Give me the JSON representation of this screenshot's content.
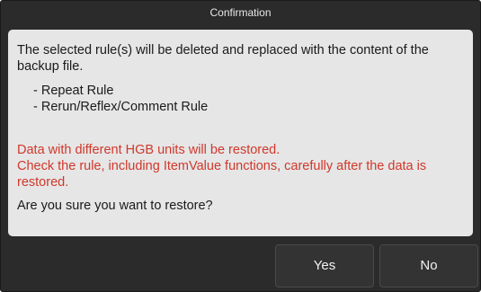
{
  "dialog": {
    "title": "Confirmation",
    "message": "The selected rule(s) will be deleted and replaced with the content of the backup file.",
    "rules": [
      "- Repeat Rule",
      "- Rerun/Reflex/Comment Rule"
    ],
    "warning_line1": "Data with different HGB units will be restored.",
    "warning_line2": "Check the rule, including ItemValue functions, carefully after the data is restored.",
    "question": "Are you sure you want to restore?",
    "warning_color": "#d0382b"
  },
  "buttons": {
    "yes_label": "Yes",
    "no_label": "No"
  }
}
